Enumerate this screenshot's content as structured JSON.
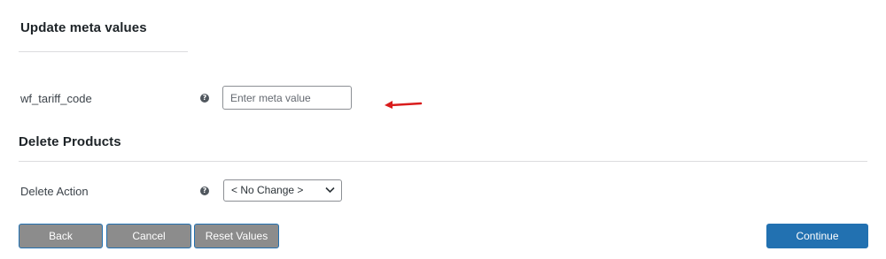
{
  "sections": {
    "update_meta": {
      "title": "Update meta values",
      "fields": [
        {
          "label": "wf_tariff_code",
          "help_icon": "question-circle-icon",
          "placeholder": "Enter meta value",
          "value": ""
        }
      ]
    },
    "delete_products": {
      "title": "Delete Products",
      "fields": [
        {
          "label": "Delete Action",
          "help_icon": "question-circle-icon",
          "selected": "< No Change >"
        }
      ]
    }
  },
  "annotation": {
    "icon": "red-arrow-icon",
    "color": "#d91c1c"
  },
  "buttons": {
    "back": "Back",
    "cancel": "Cancel",
    "reset": "Reset Values",
    "continue": "Continue"
  },
  "colors": {
    "primary": "#2271b1",
    "secondary_button": "#8c8c8c",
    "divider": "#dcdcde"
  }
}
